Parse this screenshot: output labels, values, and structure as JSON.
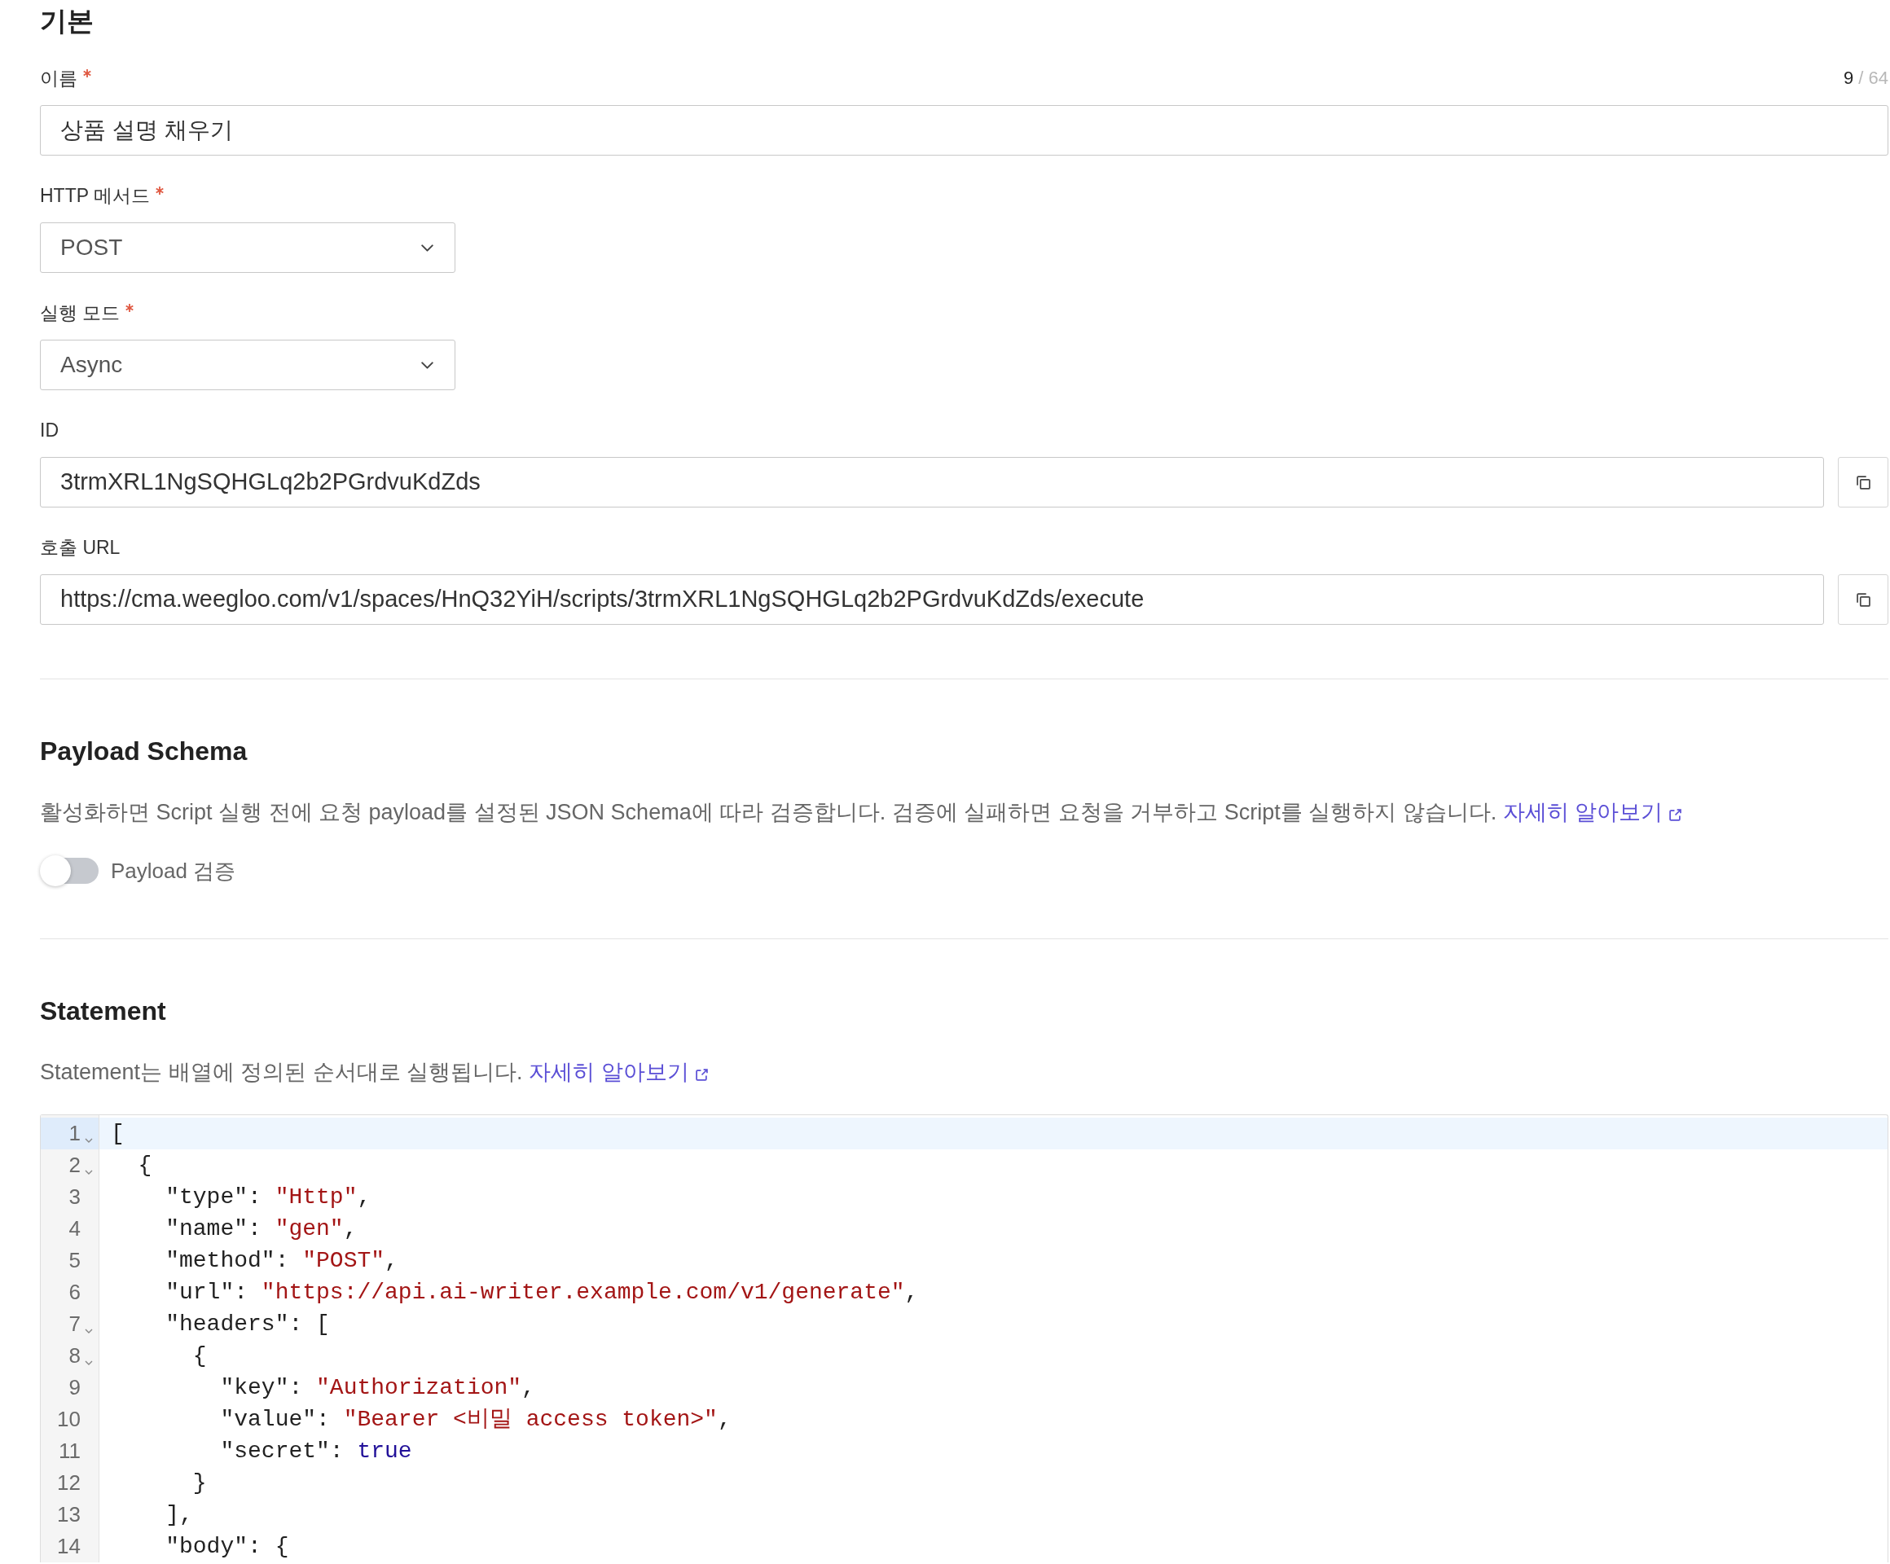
{
  "basic": {
    "title": "기본",
    "fields": [
      {
        "kind": "text",
        "label": "이름",
        "required": true,
        "value": "상품 설명 채우기",
        "counter": {
          "count": "9",
          "limit": "/ 64"
        }
      },
      {
        "kind": "select",
        "label": "HTTP 메서드",
        "required": true,
        "value": "POST"
      },
      {
        "kind": "select",
        "label": "실행 모드",
        "required": true,
        "value": "Async"
      },
      {
        "kind": "copy",
        "label": "ID",
        "required": false,
        "value": "3trmXRL1NgSQHGLq2b2PGrdvuKdZds"
      },
      {
        "kind": "copy",
        "label": "호출 URL",
        "required": false,
        "value": "https://cma.weegloo.com/v1/spaces/HnQ32YiH/scripts/3trmXRL1NgSQHGLq2b2PGrdvuKdZds/execute"
      }
    ]
  },
  "payload_schema": {
    "title": "Payload Schema",
    "description": "활성화하면 Script 실행 전에 요청 payload를 설정된 JSON Schema에 따라 검증합니다. 검증에 실패하면 요청을 거부하고 Script를 실행하지 않습니다.",
    "link": "자세히 알아보기",
    "toggle": {
      "label": "Payload 검증",
      "on": false
    }
  },
  "statement": {
    "title": "Statement",
    "description": "Statement는 배열에 정의된 순서대로 실행됩니다.",
    "link": "자세히 알아보기",
    "editor": {
      "lines": [
        {
          "number": "1",
          "foldable": true,
          "active": true,
          "tokens": [
            {
              "kind": "plain",
              "text": "["
            }
          ]
        },
        {
          "number": "2",
          "foldable": true,
          "active": false,
          "tokens": [
            {
              "kind": "plain",
              "text": "  {"
            }
          ]
        },
        {
          "number": "3",
          "foldable": false,
          "active": false,
          "tokens": [
            {
              "kind": "plain",
              "text": "    \"type\": "
            },
            {
              "kind": "string",
              "text": "\"Http\""
            },
            {
              "kind": "plain",
              "text": ","
            }
          ]
        },
        {
          "number": "4",
          "foldable": false,
          "active": false,
          "tokens": [
            {
              "kind": "plain",
              "text": "    \"name\": "
            },
            {
              "kind": "string",
              "text": "\"gen\""
            },
            {
              "kind": "plain",
              "text": ","
            }
          ]
        },
        {
          "number": "5",
          "foldable": false,
          "active": false,
          "tokens": [
            {
              "kind": "plain",
              "text": "    \"method\": "
            },
            {
              "kind": "string",
              "text": "\"POST\""
            },
            {
              "kind": "plain",
              "text": ","
            }
          ]
        },
        {
          "number": "6",
          "foldable": false,
          "active": false,
          "tokens": [
            {
              "kind": "plain",
              "text": "    \"url\": "
            },
            {
              "kind": "string",
              "text": "\"https://api.ai-writer.example.com/v1/generate\""
            },
            {
              "kind": "plain",
              "text": ","
            }
          ]
        },
        {
          "number": "7",
          "foldable": true,
          "active": false,
          "tokens": [
            {
              "kind": "plain",
              "text": "    \"headers\": ["
            }
          ]
        },
        {
          "number": "8",
          "foldable": true,
          "active": false,
          "tokens": [
            {
              "kind": "plain",
              "text": "      {"
            }
          ]
        },
        {
          "number": "9",
          "foldable": false,
          "active": false,
          "tokens": [
            {
              "kind": "plain",
              "text": "        \"key\": "
            },
            {
              "kind": "string",
              "text": "\"Authorization\""
            },
            {
              "kind": "plain",
              "text": ","
            }
          ]
        },
        {
          "number": "10",
          "foldable": false,
          "active": false,
          "tokens": [
            {
              "kind": "plain",
              "text": "        \"value\": "
            },
            {
              "kind": "string",
              "text": "\"Bearer <비밀 access token>\""
            },
            {
              "kind": "plain",
              "text": ","
            }
          ]
        },
        {
          "number": "11",
          "foldable": false,
          "active": false,
          "tokens": [
            {
              "kind": "plain",
              "text": "        \"secret\": "
            },
            {
              "kind": "keyword",
              "text": "true"
            }
          ]
        },
        {
          "number": "12",
          "foldable": false,
          "active": false,
          "tokens": [
            {
              "kind": "plain",
              "text": "      }"
            }
          ]
        },
        {
          "number": "13",
          "foldable": false,
          "active": false,
          "tokens": [
            {
              "kind": "plain",
              "text": "    ],"
            }
          ]
        },
        {
          "number": "14",
          "foldable": false,
          "active": false,
          "tokens": [
            {
              "kind": "plain",
              "text": "    \"body\": {"
            }
          ]
        }
      ]
    }
  }
}
